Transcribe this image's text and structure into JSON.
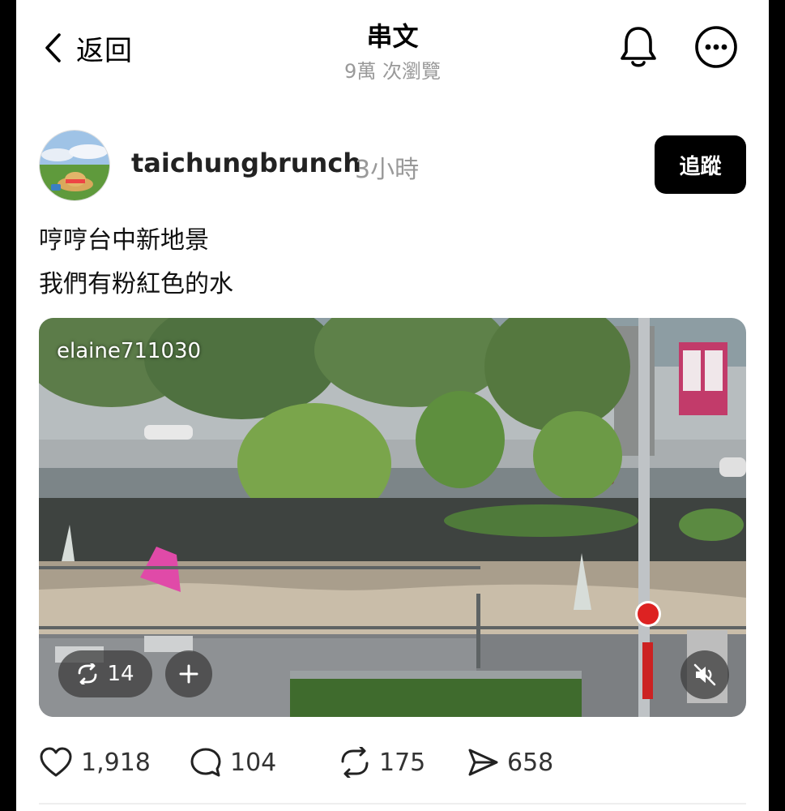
{
  "topbar": {
    "back_label": "返回",
    "title": "串文",
    "views": "9萬 次瀏覽"
  },
  "post": {
    "username": "taichungbrunch",
    "time": "3小時",
    "follow_label": "追蹤",
    "caption_lines": [
      "哼哼台中新地景",
      "我們有粉紅色的水"
    ],
    "media": {
      "watermark": "elaine711030",
      "repost_count": "14"
    },
    "actions": {
      "likes": "1,918",
      "comments": "104",
      "reposts": "175",
      "shares": "658"
    }
  },
  "colors": {
    "follow_bg": "#000000",
    "muted_text": "#999999",
    "pink_water": "#e04aa8"
  },
  "icons": [
    "chevron-left-icon",
    "bell-icon",
    "more-icon",
    "repost-icon",
    "plus-icon",
    "mute-icon",
    "heart-icon",
    "comment-icon",
    "share-icon"
  ]
}
